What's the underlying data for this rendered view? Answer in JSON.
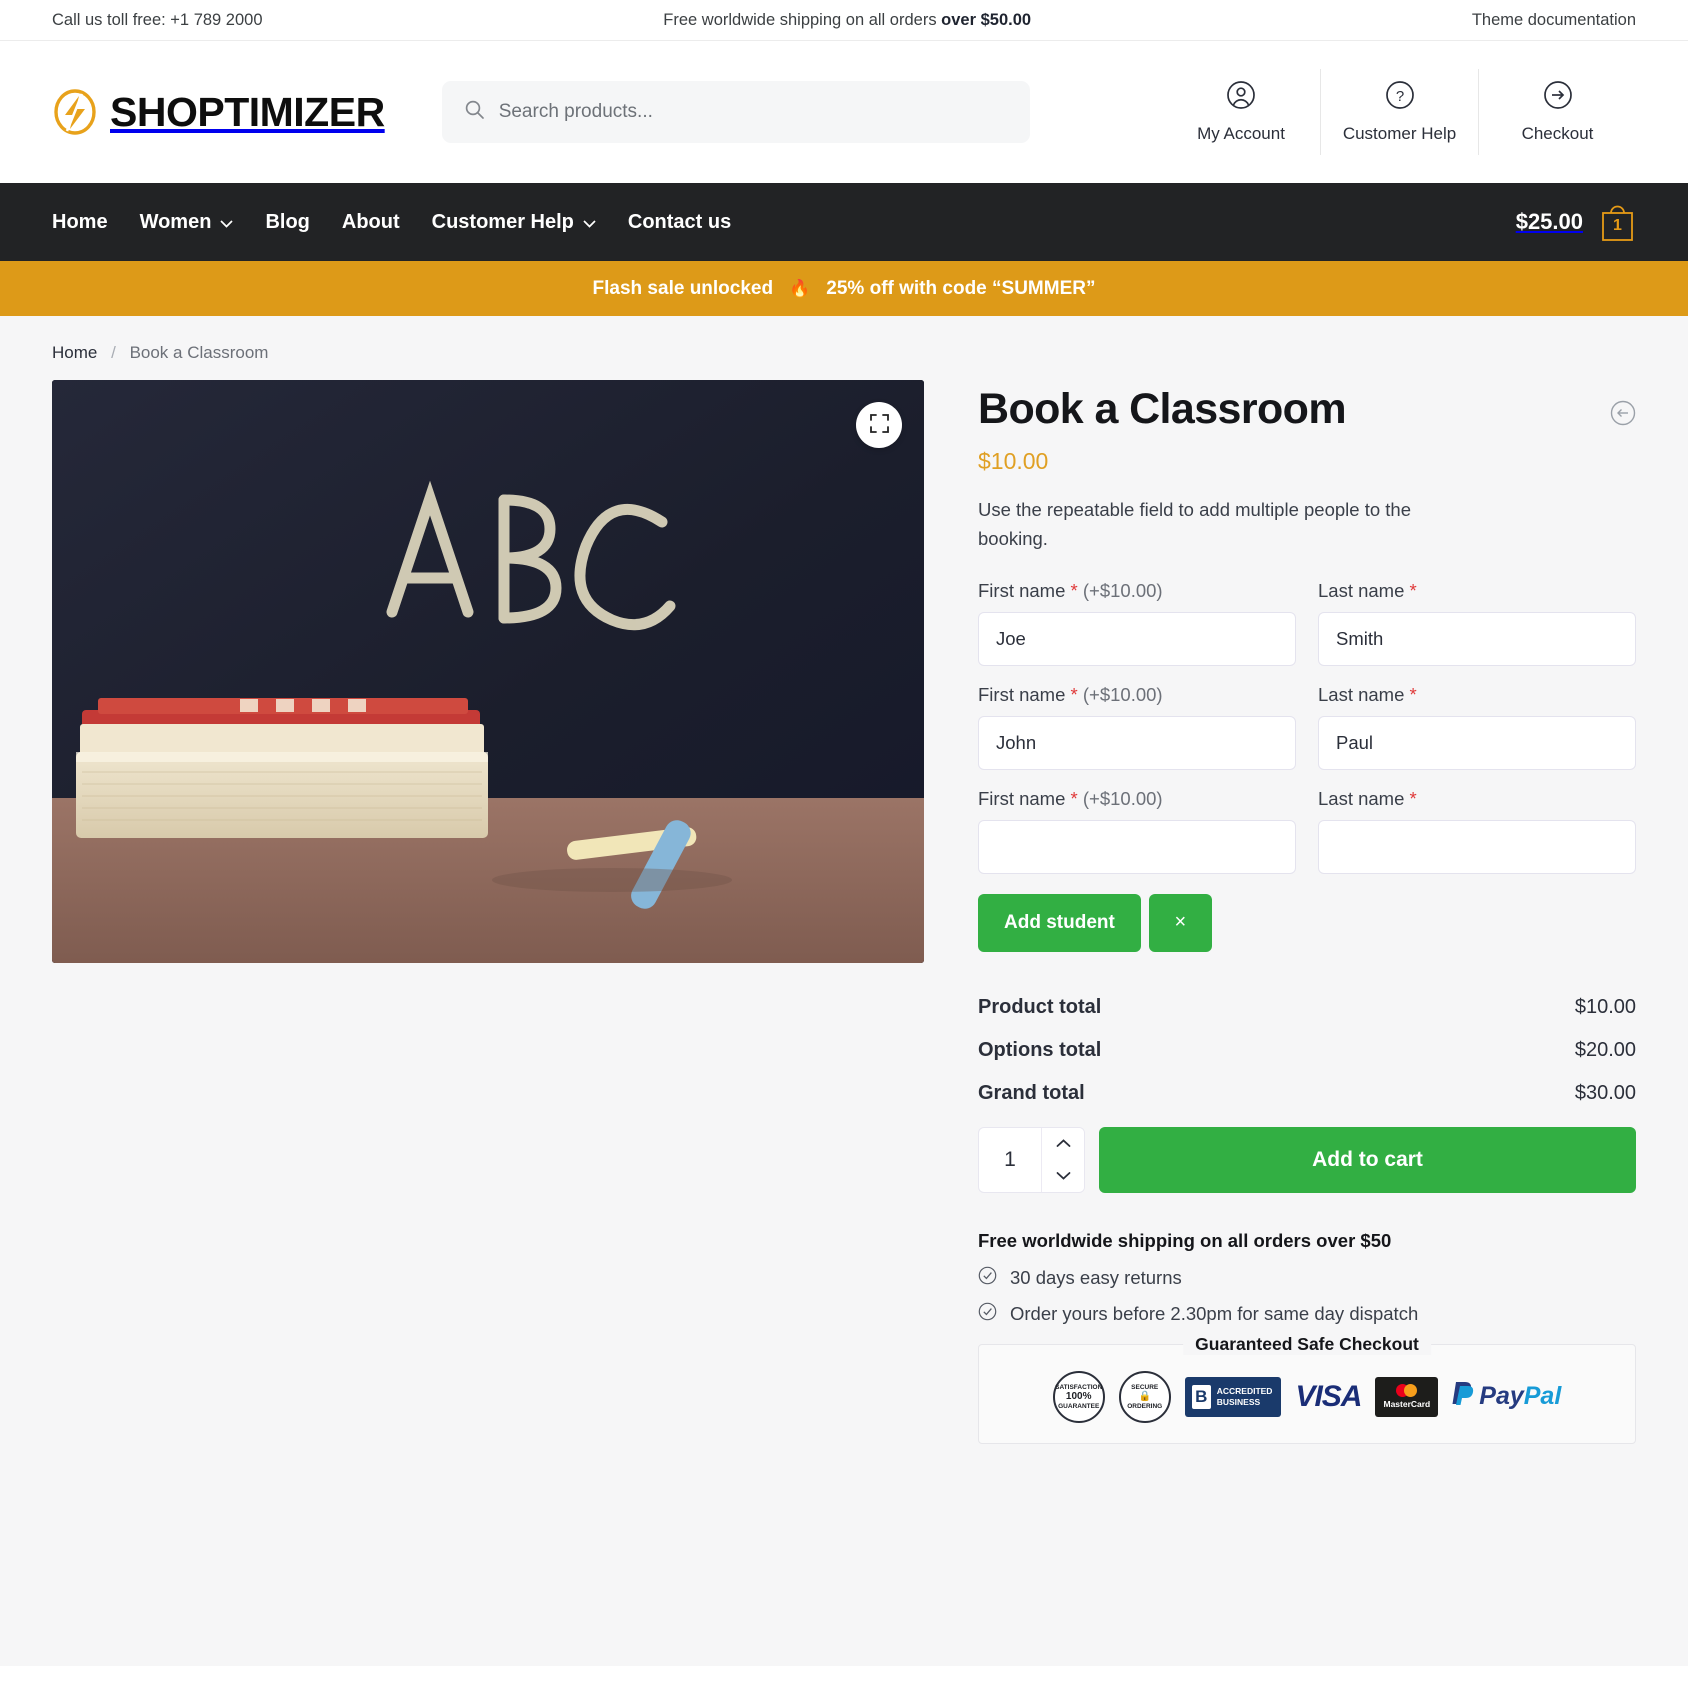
{
  "topbar": {
    "phone": "Call us toll free: +1 789 2000",
    "shipping_prefix": "Free worldwide shipping on all orders ",
    "shipping_bold": "over $50.00",
    "docs": "Theme documentation"
  },
  "header": {
    "brand": "SHOPTIMIZER",
    "logo_icon": "lightning-bolt-icon",
    "search_placeholder": "Search products...",
    "search_value": "",
    "actions": [
      {
        "label": "My Account",
        "icon": "user-circle-icon"
      },
      {
        "label": "Customer Help",
        "icon": "question-circle-icon"
      },
      {
        "label": "Checkout",
        "icon": "arrow-right-circle-icon"
      }
    ]
  },
  "nav": {
    "items": [
      {
        "label": "Home",
        "has_caret": false
      },
      {
        "label": "Women",
        "has_caret": true
      },
      {
        "label": "Blog",
        "has_caret": false
      },
      {
        "label": "About",
        "has_caret": false
      },
      {
        "label": "Customer Help",
        "has_caret": true
      },
      {
        "label": "Contact us",
        "has_caret": false
      }
    ],
    "cart_total": "$25.00",
    "cart_count": "1"
  },
  "flash": {
    "left": "Flash sale unlocked",
    "flame": "🔥",
    "right": "25% off with code “SUMMER”"
  },
  "breadcrumb": {
    "home": "Home",
    "separator": "/",
    "current": "Book a Classroom"
  },
  "gallery": {
    "zoom_icon": "expand-icon",
    "alt": "Chalkboard with ABC written in chalk, stacked books and chalk sticks"
  },
  "product": {
    "title": "Book a Classroom",
    "price": "$10.00",
    "back_icon": "arrow-left-circle-icon",
    "description": "Use the repeatable field to add multiple people to the booking.",
    "field_rows": [
      {
        "first_label": "First name",
        "first_required": "*",
        "first_price": "(+$10.00)",
        "first_value": "Joe",
        "last_label": "Last name",
        "last_required": "*",
        "last_value": "Smith"
      },
      {
        "first_label": "First name",
        "first_required": "*",
        "first_price": "(+$10.00)",
        "first_value": "John",
        "last_label": "Last name",
        "last_required": "*",
        "last_value": "Paul"
      },
      {
        "first_label": "First name",
        "first_required": "*",
        "first_price": "(+$10.00)",
        "first_value": "",
        "last_label": "Last name",
        "last_required": "*",
        "last_value": ""
      }
    ],
    "add_student_label": "Add student",
    "remove_label": "×",
    "totals": [
      {
        "label": "Product total",
        "value": "$10.00"
      },
      {
        "label": "Options total",
        "value": "$20.00"
      },
      {
        "label": "Grand total",
        "value": "$30.00"
      }
    ],
    "quantity": "1",
    "add_to_cart_label": "Add to cart",
    "shipping_note": "Free worldwide shipping on all orders over $50",
    "perks": [
      "30 days easy returns",
      "Order yours before 2.30pm for same day dispatch"
    ],
    "safe_checkout_title": "Guaranteed Safe Checkout",
    "badges": [
      {
        "name": "satisfaction-guarantee-seal",
        "top": "SATISFACTION",
        "mid": "100%",
        "bottom": "GUARANTEE"
      },
      {
        "name": "secure-ordering-seal",
        "top": "SECURE",
        "mid": "🔒",
        "bottom": "ORDERING"
      },
      {
        "name": "bbb-accredited-business-badge",
        "letter": "B",
        "line1": "ACCREDITED",
        "line2": "BUSINESS"
      },
      {
        "name": "visa-logo",
        "text": "VISA"
      },
      {
        "name": "mastercard-logo",
        "text": "MasterCard"
      },
      {
        "name": "paypal-logo",
        "text_a": "Pay",
        "text_b": "Pal"
      }
    ]
  },
  "colors": {
    "brand_orange": "#e0a024",
    "flash_bg": "#dd9a18",
    "nav_bg": "#222325",
    "green": "#32af43",
    "required_red": "#e03b3b"
  }
}
